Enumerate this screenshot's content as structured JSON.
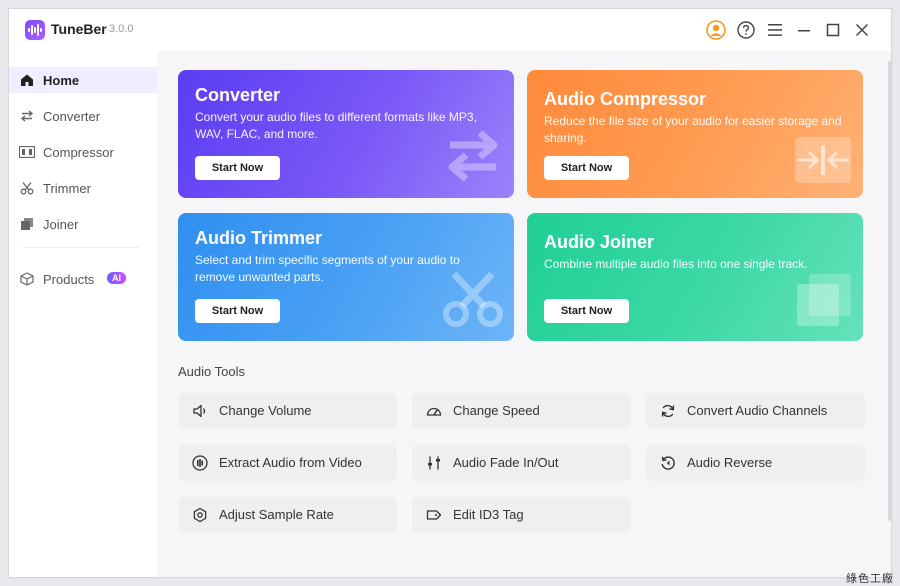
{
  "app": {
    "name": "TuneBer",
    "version": "3.0.0"
  },
  "sidebar": {
    "items": [
      {
        "label": "Home",
        "icon": "home-icon"
      },
      {
        "label": "Converter",
        "icon": "convert-arrows-icon"
      },
      {
        "label": "Compressor",
        "icon": "compress-icon"
      },
      {
        "label": "Trimmer",
        "icon": "scissors-icon"
      },
      {
        "label": "Joiner",
        "icon": "stack-icon"
      },
      {
        "label": "Products",
        "icon": "cube-icon",
        "badge": "AI"
      }
    ]
  },
  "cards": [
    {
      "title": "Converter",
      "desc": "Convert your audio files to different formats like MP3, WAV, FLAC, and more.",
      "button": "Start Now"
    },
    {
      "title": "Audio Compressor",
      "desc": "Reduce the file size of your audio for easier storage and sharing.",
      "button": "Start Now"
    },
    {
      "title": "Audio Trimmer",
      "desc": "Select and trim specific segments of your audio to remove unwanted parts.",
      "button": "Start Now"
    },
    {
      "title": "Audio Joiner",
      "desc": "Combine multiple audio files into one single track.",
      "button": "Start Now"
    }
  ],
  "tools": {
    "title": "Audio Tools",
    "items": [
      {
        "label": "Change Volume",
        "icon": "speaker-icon"
      },
      {
        "label": "Change Speed",
        "icon": "speedometer-icon"
      },
      {
        "label": "Convert Audio Channels",
        "icon": "rotate-icon"
      },
      {
        "label": "Extract Audio from Video",
        "icon": "audio-extract-icon"
      },
      {
        "label": "Audio Fade In/Out",
        "icon": "sliders-icon"
      },
      {
        "label": "Audio Reverse",
        "icon": "reverse-icon"
      },
      {
        "label": "Adjust Sample Rate",
        "icon": "sample-rate-icon"
      },
      {
        "label": "Edit ID3 Tag",
        "icon": "tag-icon"
      }
    ]
  },
  "watermark": "綠色工廠",
  "colors": {
    "accent": "#7b4dff",
    "converter": "#6a4cf4",
    "compressor": "#ff9447",
    "trimmer": "#3f9af2",
    "joiner": "#2fd49e",
    "user_icon": "#f39a1f"
  }
}
